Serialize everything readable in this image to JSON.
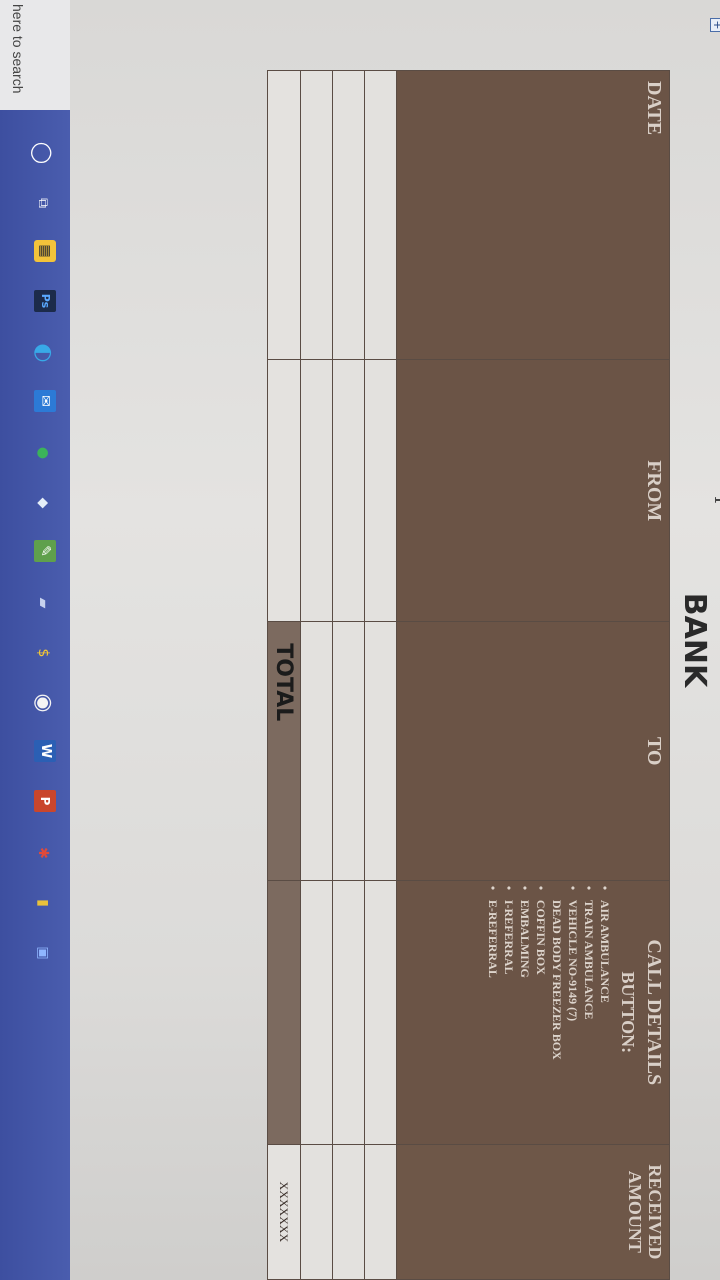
{
  "document": {
    "title": "BANK",
    "table_handle_glyph": "+",
    "cursor_glyph": "I",
    "table": {
      "columns": [
        "DATE",
        "FROM",
        "TO",
        "CALL DETAILS",
        "RECEIVED AMOUNT"
      ],
      "call_details": {
        "heading": "CALL DETAILS",
        "subheading": "BUTTON:",
        "items": [
          {
            "text": "AIR AMBULANCE",
            "bullet": true
          },
          {
            "text": "TRAIN AMBULANCE",
            "bullet": true
          },
          {
            "text": "VEHICLE NO-9149 (7)",
            "bullet": true
          },
          {
            "text": "DEAD BODY FREEZER BOX",
            "bullet": false
          },
          {
            "text": "COFFIN BOX",
            "bullet": true
          },
          {
            "text": "EMBALMING",
            "bullet": true
          },
          {
            "text": "I-REFERRAL",
            "bullet": true
          },
          {
            "text": "E-REFERRAL",
            "bullet": true
          }
        ]
      },
      "empty_rows": 3,
      "total_label": "TOTAL",
      "total_amount": "XXXXXXX"
    }
  },
  "taskbar": {
    "search_placeholder": "here to search",
    "icons": [
      "start-icon",
      "task-view-icon",
      "store-icon",
      "photoshop-icon",
      "edge-icon",
      "mail-icon",
      "chrome-icon",
      "word-icon",
      "powerpoint-icon"
    ]
  },
  "colors": {
    "header_bg": "#6b5446",
    "total_bg": "#7c6a5f",
    "taskbar_bg": "#3d4fa0"
  }
}
